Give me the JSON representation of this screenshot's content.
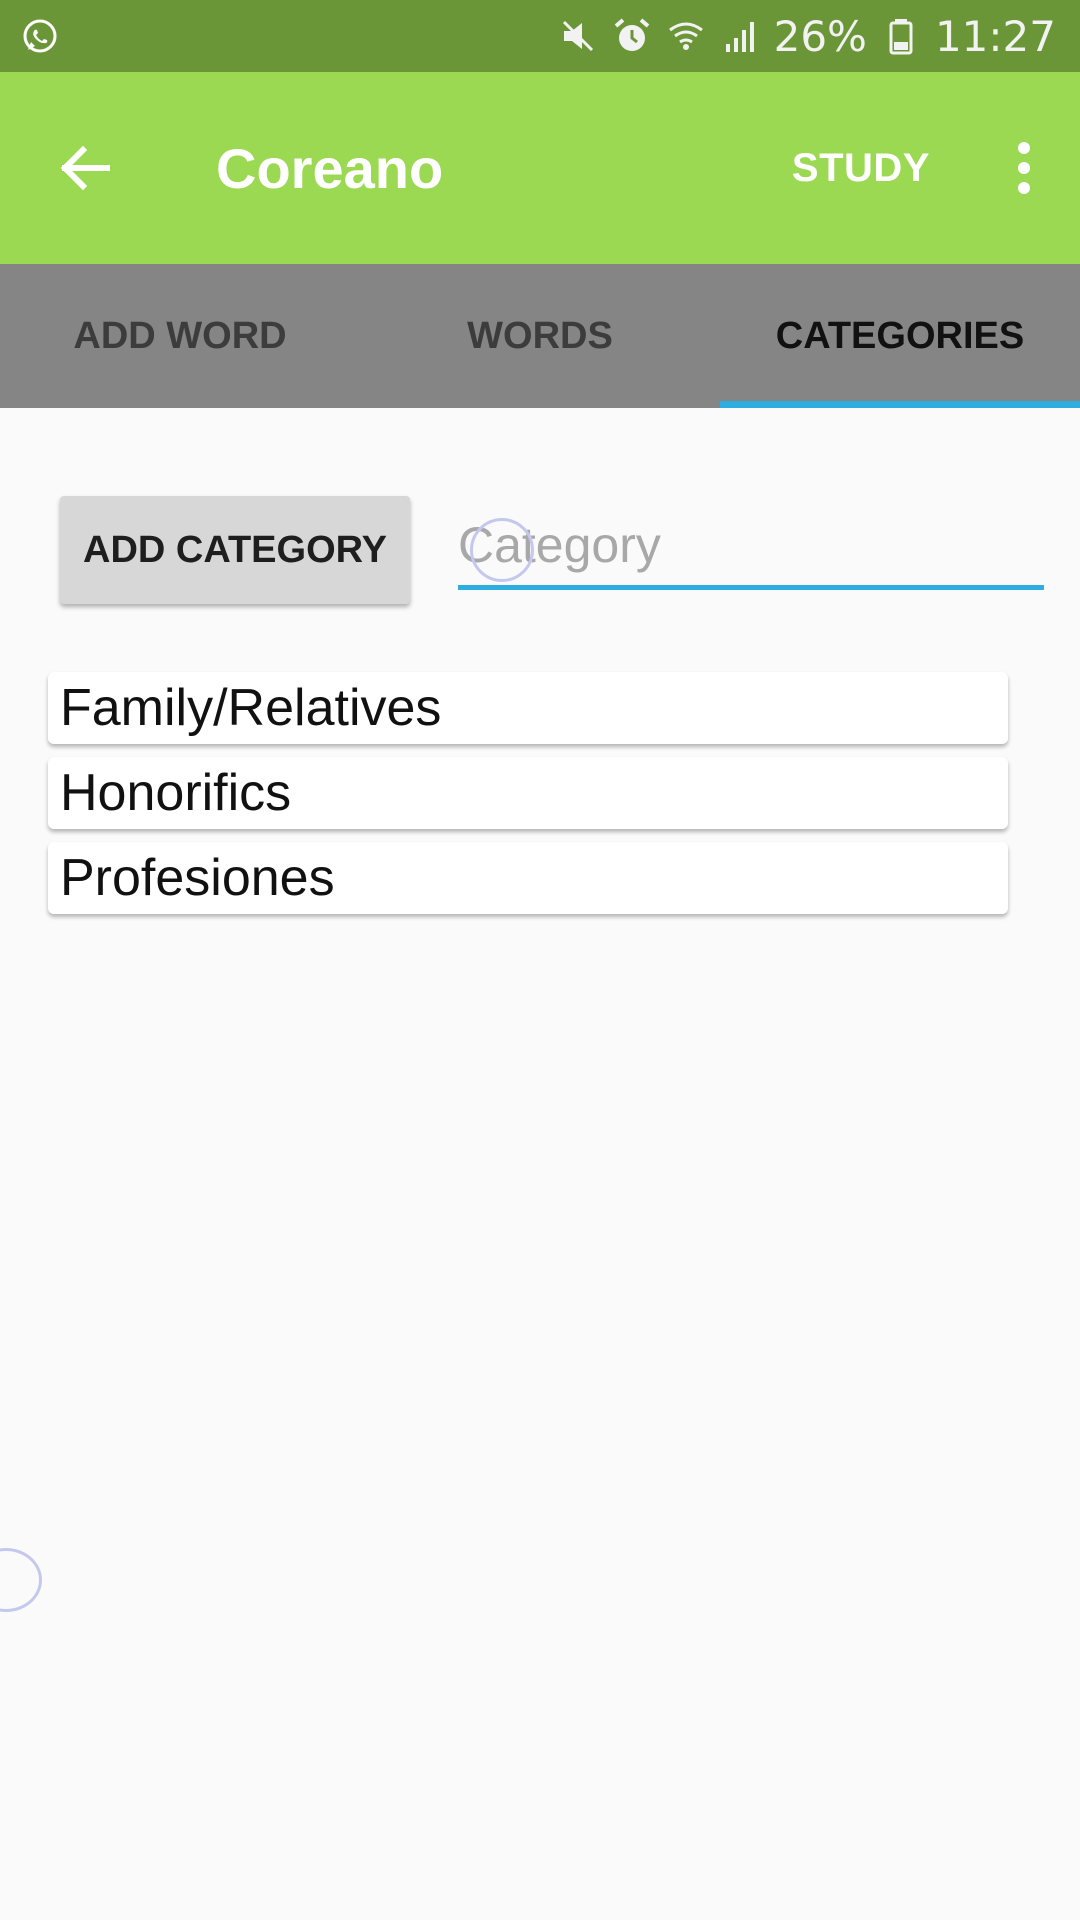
{
  "status_bar": {
    "battery": "26%",
    "time": "11:27",
    "icons": [
      "whatsapp-icon",
      "mute-icon",
      "alarm-icon",
      "wifi-icon",
      "signal-icon",
      "battery-icon"
    ]
  },
  "app_bar": {
    "title": "Coreano",
    "study_label": "STUDY"
  },
  "tabs": [
    {
      "label": "ADD WORD",
      "active": false
    },
    {
      "label": "WORDS",
      "active": false
    },
    {
      "label": "CATEGORIES",
      "active": true
    }
  ],
  "add_category": {
    "button_label": "ADD CATEGORY",
    "input_placeholder": "Category",
    "input_value": ""
  },
  "categories": [
    "Family/Relatives",
    "Honorifics",
    "Profesiones"
  ],
  "colors": {
    "status_bar": "#6b9638",
    "app_bar": "#9cd952",
    "tab_bar": "#858585",
    "accent": "#2eaee0",
    "background": "#fafafa"
  }
}
